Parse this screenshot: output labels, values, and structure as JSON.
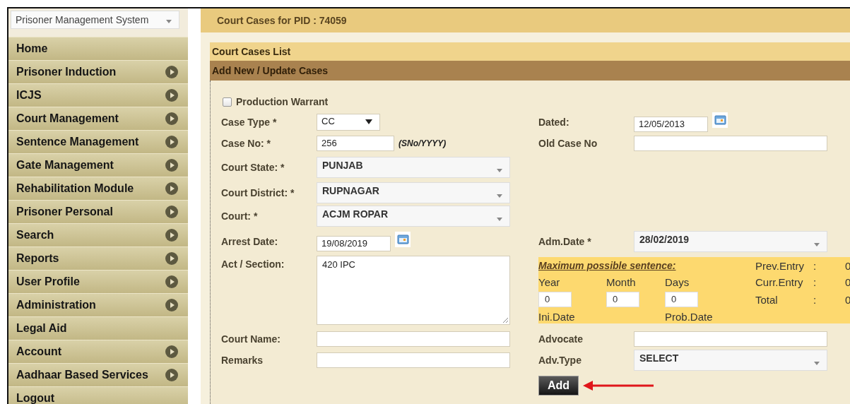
{
  "app_switcher": {
    "value": "Prisoner Management System"
  },
  "sidebar": {
    "items": [
      {
        "label": "Home",
        "has_submenu": false
      },
      {
        "label": "Prisoner Induction",
        "has_submenu": true
      },
      {
        "label": "ICJS",
        "has_submenu": true
      },
      {
        "label": "Court Management",
        "has_submenu": true
      },
      {
        "label": "Sentence Management",
        "has_submenu": true
      },
      {
        "label": "Gate Management",
        "has_submenu": true
      },
      {
        "label": "Rehabilitation Module",
        "has_submenu": true
      },
      {
        "label": "Prisoner Personal",
        "has_submenu": true
      },
      {
        "label": "Search",
        "has_submenu": true
      },
      {
        "label": "Reports",
        "has_submenu": true
      },
      {
        "label": "User Profile",
        "has_submenu": true
      },
      {
        "label": "Administration",
        "has_submenu": true
      },
      {
        "label": "Legal Aid",
        "has_submenu": false
      },
      {
        "label": "Account",
        "has_submenu": true
      },
      {
        "label": "Aadhaar Based Services",
        "has_submenu": true
      },
      {
        "label": "Logout",
        "has_submenu": false
      }
    ]
  },
  "page_title": "Court Cases for PID : 74059",
  "sections": [
    {
      "title": "Court Cases List",
      "kind": "list"
    },
    {
      "title": "Add New / Update Cases",
      "kind": "form"
    }
  ],
  "form": {
    "production_warrant": {
      "label": "Production Warrant",
      "checked": false
    },
    "left_fields": [
      {
        "label": "Case Type *",
        "kind": "small_select",
        "value": "CC"
      },
      {
        "label": "Case No: *",
        "kind": "short_text",
        "value": "256",
        "hint": "(SNo/YYYY)"
      },
      {
        "label": "Court State: *",
        "kind": "select",
        "value": "PUNJAB"
      },
      {
        "label": "Court District: *",
        "kind": "select",
        "value": "RUPNAGAR"
      },
      {
        "label": "Court: *",
        "kind": "select",
        "value": "ACJM ROPAR"
      },
      {
        "label": "Arrest Date:",
        "kind": "date",
        "value": "19/08/2019"
      },
      {
        "label": "Act / Section:",
        "kind": "textarea",
        "value": "420 IPC"
      },
      {
        "label": "Court Name:",
        "kind": "text"
      },
      {
        "label": "Remarks",
        "kind": "text"
      }
    ],
    "right_fields": [
      {
        "label": "Dated:",
        "kind": "date",
        "value": "12/05/2013"
      },
      {
        "label": "Old Case No",
        "kind": "text"
      },
      {
        "label": "Adm.Date *",
        "kind": "select",
        "value": "28/02/2019"
      },
      {
        "kind": "sentence"
      },
      {
        "label": "Advocate",
        "kind": "text"
      },
      {
        "label": "Adv.Type",
        "kind": "select",
        "value": "SELECT"
      }
    ],
    "sentence": {
      "title": "Maximum possible sentence:",
      "parts": [
        {
          "label": "Year",
          "value": "0"
        },
        {
          "label": "Month",
          "value": "0"
        },
        {
          "label": "Days",
          "value": "0"
        }
      ],
      "dates": [
        "Ini.Date",
        "Prob.Date"
      ],
      "entries": [
        {
          "label": "Prev.Entry",
          "colon": ":",
          "value": "0"
        },
        {
          "label": "Curr.Entry",
          "colon": ":",
          "value": "0"
        },
        {
          "label": "Total",
          "colon": ":",
          "value": "0"
        }
      ]
    },
    "submit": "Add"
  }
}
